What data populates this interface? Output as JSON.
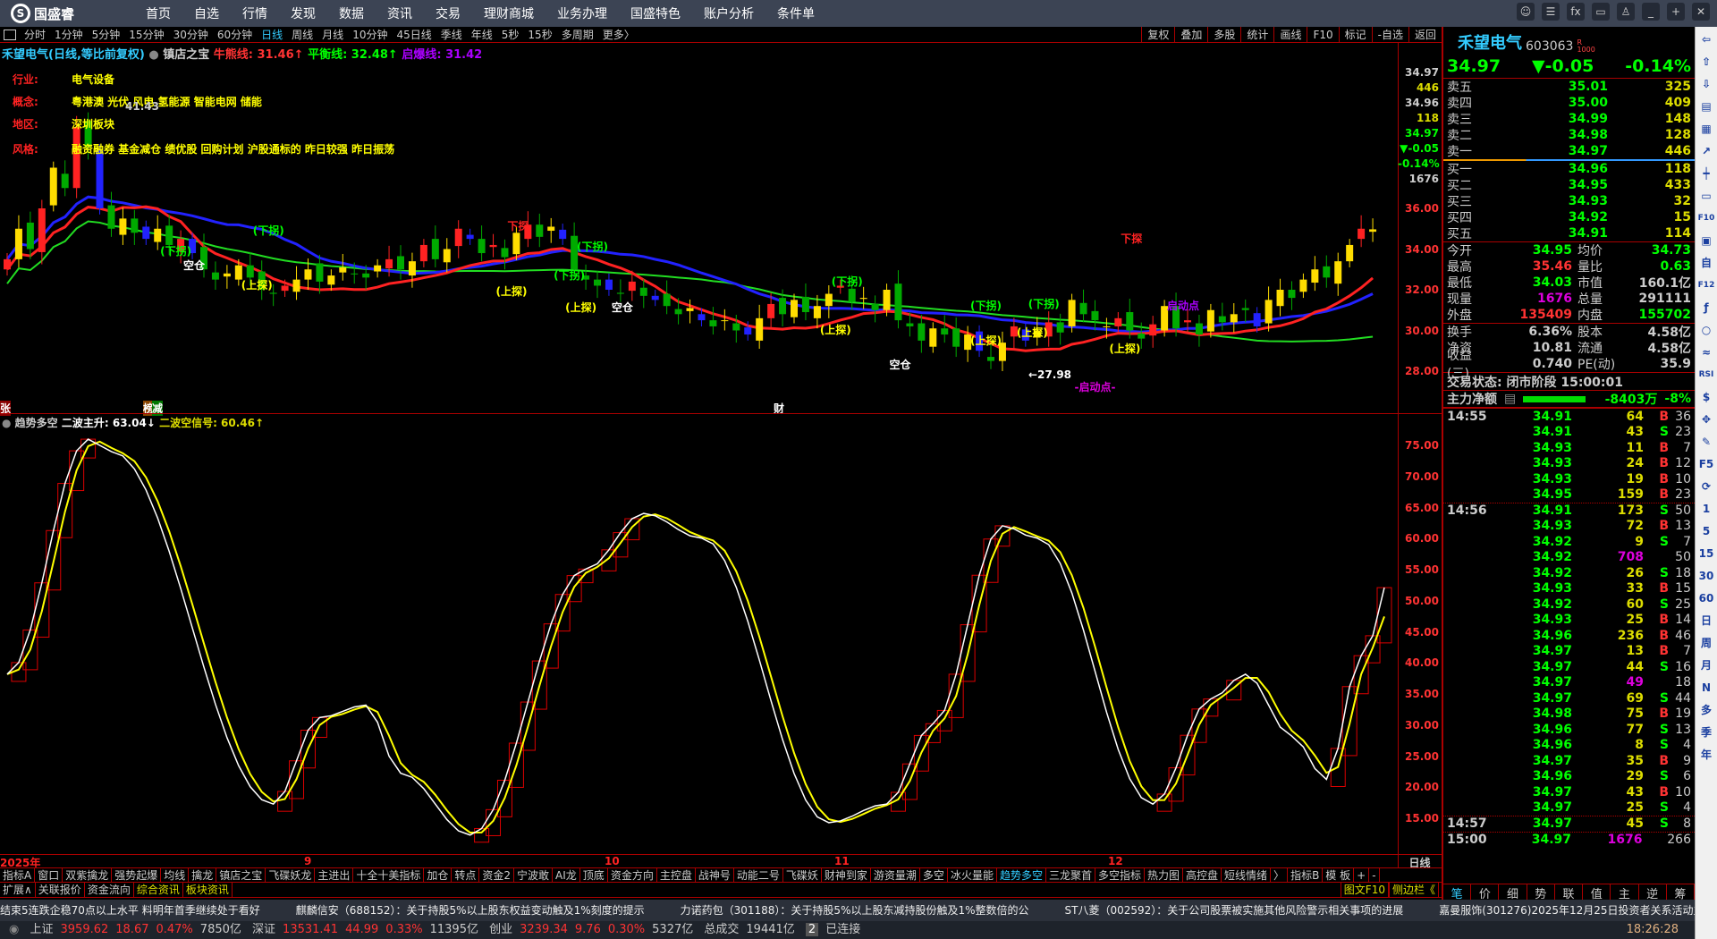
{
  "app": {
    "logo": "国盛睿",
    "menu": [
      "首页",
      "自选",
      "行情",
      "发现",
      "数据",
      "资讯",
      "交易",
      "理财商城",
      "业务办理",
      "国盛特色",
      "账户分析",
      "条件单"
    ],
    "window_buttons": [
      "chat-icon",
      "settings-sliders-icon",
      "fx-icon",
      "monitor-icon",
      "skin-icon",
      "minimize-icon",
      "restore-icon",
      "close-icon"
    ]
  },
  "toolbar": {
    "periods": [
      "分时",
      "1分钟",
      "5分钟",
      "15分钟",
      "30分钟",
      "60分钟",
      "日线",
      "周线",
      "月线",
      "10分钟",
      "45日线",
      "季线",
      "年线",
      "5秒",
      "15秒",
      "多周期",
      "更多〉"
    ],
    "active": "日线",
    "right": [
      "复权",
      "叠加",
      "多股",
      "统计",
      "画线",
      "F10",
      "标记",
      "-自选",
      "返回"
    ]
  },
  "chart": {
    "title": "禾望电气(日线,等比前复权)",
    "indicator": "镇店之宝",
    "bull_line": "牛熊线: 31.46↑",
    "balance_line": "平衡线: 32.48↑",
    "burst_line": "启爆线: 31.42",
    "info": [
      {
        "k": "行业:",
        "v": "电气设备"
      },
      {
        "k": "概念:",
        "v": "粤港澳 光伏 风电 氢能源 智能电网 储能"
      },
      {
        "k": "地区:",
        "v": "深圳板块"
      },
      {
        "k": "风格:",
        "v": "融资融券 基金减仓 绩优股 回购计划 沪股通标的 昨日较强 昨日振荡"
      }
    ],
    "high_label": "41.43",
    "low_label": "←27.98",
    "markers": [
      "张",
      "榜",
      "减",
      "财"
    ],
    "annotations": [
      {
        "t": "(下拐)",
        "c": "#0f0",
        "idx": 22,
        "p": 35.3
      },
      {
        "t": "(下拐)",
        "c": "#0f0",
        "idx": 14,
        "p": 34.3
      },
      {
        "t": "空仓",
        "c": "#fff",
        "idx": 16,
        "p": 33.6
      },
      {
        "t": "(上探)",
        "c": "#ff0",
        "idx": 21,
        "p": 32.6
      },
      {
        "t": "下探",
        "c": "#f22",
        "idx": 44,
        "p": 35.5
      },
      {
        "t": "(上探)",
        "c": "#ff0",
        "idx": 43,
        "p": 32.3
      },
      {
        "t": "(下拐)",
        "c": "#0f0",
        "idx": 48,
        "p": 33.1
      },
      {
        "t": "(下拐)",
        "c": "#0f0",
        "idx": 50,
        "p": 34.5
      },
      {
        "t": "(上探)",
        "c": "#ff0",
        "idx": 49,
        "p": 31.5
      },
      {
        "t": "空仓",
        "c": "#fff",
        "idx": 53,
        "p": 31.5
      },
      {
        "t": "(下拐)",
        "c": "#0f0",
        "idx": 72,
        "p": 32.8
      },
      {
        "t": "(上探)",
        "c": "#ff0",
        "idx": 71,
        "p": 30.4
      },
      {
        "t": "空仓",
        "c": "#fff",
        "idx": 77,
        "p": 28.7
      },
      {
        "t": "(下拐)",
        "c": "#0f0",
        "idx": 84,
        "p": 31.6
      },
      {
        "t": "(上探)",
        "c": "#ff0",
        "idx": 84,
        "p": 29.9
      },
      {
        "t": "(下拐)",
        "c": "#0f0",
        "idx": 89,
        "p": 31.7
      },
      {
        "t": "(上探)",
        "c": "#ff0",
        "idx": 96,
        "p": 29.5
      },
      {
        "t": "(上探)",
        "c": "#ff0",
        "idx": 88,
        "p": 30.3
      },
      {
        "t": "下探",
        "c": "#f22",
        "idx": 97,
        "p": 34.9
      },
      {
        "t": "启动点",
        "c": "#a0f",
        "idx": 101,
        "p": 31.6
      },
      {
        "t": "-启动点-",
        "c": "#d0d",
        "idx": 93,
        "p": 27.6
      }
    ],
    "price_axis": [
      "36.00",
      "34.00",
      "32.00",
      "30.00",
      "28.00"
    ],
    "axis_quote": [
      {
        "t": "34.97",
        "c": "#ccc"
      },
      {
        "t": "446",
        "c": "#dd0"
      },
      {
        "t": "34.96",
        "c": "#ccc"
      },
      {
        "t": "118",
        "c": "#dd0"
      },
      {
        "t": "34.97",
        "c": "#0f0"
      },
      {
        "t": "▼-0.05",
        "c": "#0f0"
      },
      {
        "t": "-0.14%",
        "c": "#0f0"
      },
      {
        "t": "1676",
        "c": "#ccc"
      }
    ],
    "closes": [
      33.5,
      35,
      34,
      36,
      38,
      37,
      40,
      39,
      36,
      35,
      35.5,
      34.8,
      34.5,
      35,
      34.2,
      34.5,
      33.8,
      33,
      32.5,
      32.8,
      33.2,
      32.6,
      32.0,
      31.8,
      32.2,
      32.5,
      33,
      32.4,
      32.7,
      33.1,
      32.8,
      32.6,
      33.2,
      33.5,
      33.0,
      33.4,
      34.2,
      33.5,
      34,
      35.0,
      34.5,
      33.8,
      34.2,
      33.6,
      34.8,
      35.2,
      34.6,
      35.1,
      34.5,
      33,
      32.5,
      32.2,
      32.0,
      31.8,
      32.4,
      31.7,
      31.5,
      31.2,
      30.8,
      31.1,
      30.5,
      30.2,
      30.5,
      30.0,
      29.8,
      30.6,
      31.3,
      30.8,
      31.5,
      30.9,
      31.2,
      31.8,
      32.2,
      31.4,
      31.6,
      31.0,
      32.0,
      30.5,
      30.2,
      29.5,
      30.1,
      29.8,
      29.2,
      29.8,
      29.0,
      28.5,
      29.4,
      30.2,
      29.5,
      30.0,
      30.4,
      29.9,
      31.5,
      30.8,
      30.5,
      30.2,
      30.6,
      30.0,
      29.6,
      30.3,
      31.2,
      30.1,
      30.5,
      29.8,
      31,
      30.4,
      30.8,
      31.0,
      30.2,
      31.5,
      32.0,
      31.6,
      32.5,
      33.0,
      32.6,
      33.4,
      34.2,
      35.0,
      34.97
    ]
  },
  "indicator": {
    "name": "趋势多空",
    "main": "二波主升: 63.04↓",
    "signal": "二波空信号: 60.46↑",
    "axis": [
      "75.00",
      "70.00",
      "65.00",
      "60.00",
      "55.00",
      "50.00",
      "45.00",
      "40.00",
      "35.00",
      "30.00",
      "25.00",
      "20.00",
      "15.00"
    ],
    "keypoints": [
      [
        0,
        38
      ],
      [
        7,
        76
      ],
      [
        9,
        74
      ],
      [
        23,
        17
      ],
      [
        27,
        31
      ],
      [
        31,
        33
      ],
      [
        34,
        22
      ],
      [
        40,
        12
      ],
      [
        50,
        55
      ],
      [
        55,
        64
      ],
      [
        60,
        60
      ],
      [
        71,
        14
      ],
      [
        76,
        17
      ],
      [
        80,
        30
      ],
      [
        86,
        62
      ],
      [
        89,
        60
      ],
      [
        99,
        17
      ],
      [
        104,
        34
      ],
      [
        107,
        38
      ],
      [
        111,
        28
      ],
      [
        114,
        21
      ],
      [
        117,
        41
      ],
      [
        121,
        63
      ],
      [
        122,
        62
      ]
    ]
  },
  "date_axis": {
    "labels": [
      "2025年",
      "9",
      "10",
      "11",
      "12"
    ],
    "period": "日线"
  },
  "tabs_row1": [
    "指标A",
    "窗口",
    "双紫擒龙",
    "强势起爆",
    "均线",
    "擒龙",
    "镇店之宝",
    "飞碟妖龙",
    "主进出",
    "十全十美指标",
    "加仓",
    "转点",
    "资金2",
    "宁波敢",
    "AI龙",
    "顶底",
    "资金方向",
    "主控盘",
    "战神号",
    "动能二号",
    "飞碟妖",
    "财神到家",
    "游资量潮",
    "多空",
    "冰火量能",
    "趋势多空",
    "三龙聚首",
    "多空指标",
    "热力图",
    "高控盘",
    "短线情绪",
    "〉",
    "指标B",
    "模 板",
    "+",
    "-"
  ],
  "tabs_row1_active": "趋势多空",
  "tabs_row2": [
    "扩展∧",
    "关联报价",
    "资金流向",
    "综合资讯",
    "板块资讯"
  ],
  "tabs_row2_right": [
    "图文F10",
    "侧边栏《"
  ],
  "quote": {
    "name": "禾望电气",
    "code": "603063",
    "tag_r": "R",
    "tag_num": "1000",
    "price": "34.97",
    "change": "▼-0.05",
    "pct": "-0.14%",
    "asks": [
      {
        "l": "卖五",
        "p": "35.01",
        "v": "325"
      },
      {
        "l": "卖四",
        "p": "35.00",
        "v": "409"
      },
      {
        "l": "卖三",
        "p": "34.99",
        "v": "148"
      },
      {
        "l": "卖二",
        "p": "34.98",
        "v": "128"
      },
      {
        "l": "卖一",
        "p": "34.97",
        "v": "446"
      }
    ],
    "bids": [
      {
        "l": "买一",
        "p": "34.96",
        "v": "118"
      },
      {
        "l": "买二",
        "p": "34.95",
        "v": "433"
      },
      {
        "l": "买三",
        "p": "34.93",
        "v": "32"
      },
      {
        "l": "买四",
        "p": "34.92",
        "v": "15"
      },
      {
        "l": "买五",
        "p": "34.91",
        "v": "114"
      }
    ],
    "stats": [
      [
        "今开",
        "34.95",
        "g",
        "均价",
        "34.73",
        "g"
      ],
      [
        "最高",
        "35.46",
        "r",
        "量比",
        "0.63",
        "g"
      ],
      [
        "最低",
        "34.03",
        "g",
        "市值",
        "160.1亿",
        "w"
      ],
      [
        "现量",
        "1676",
        "p",
        "总量",
        "291111",
        "w"
      ],
      [
        "外盘",
        "135409",
        "r",
        "内盘",
        "155702",
        "g"
      ]
    ],
    "stats2": [
      [
        "换手",
        "6.36%",
        "w",
        "股本",
        "4.58亿",
        "w"
      ],
      [
        "净资",
        "10.81",
        "w",
        "流通",
        "4.58亿",
        "w"
      ],
      [
        "收益(三)",
        "0.740",
        "w",
        "PE(动)",
        "35.9",
        "w"
      ]
    ],
    "trade_status": "交易状态: 闭市阶段 15:00:01",
    "main_net_label": "主力净额",
    "main_net": "-8403万",
    "main_net_pct": "-8%"
  },
  "ticks": [
    [
      "14:55",
      "34.91",
      "64",
      "B",
      "36"
    ],
    [
      "",
      "34.91",
      "43",
      "S",
      "23"
    ],
    [
      "",
      "34.93",
      "11",
      "B",
      "7"
    ],
    [
      "",
      "34.93",
      "24",
      "B",
      "12"
    ],
    [
      "",
      "34.93",
      "19",
      "B",
      "10"
    ],
    [
      "",
      "34.95",
      "159",
      "B",
      "23"
    ],
    [
      "14:56",
      "34.91",
      "173",
      "S",
      "50"
    ],
    [
      "",
      "34.93",
      "72",
      "B",
      "13"
    ],
    [
      "",
      "34.92",
      "9",
      "S",
      "7"
    ],
    [
      "",
      "34.92",
      "708",
      "",
      "50"
    ],
    [
      "",
      "34.92",
      "26",
      "S",
      "18"
    ],
    [
      "",
      "34.93",
      "33",
      "B",
      "15"
    ],
    [
      "",
      "34.92",
      "60",
      "S",
      "25"
    ],
    [
      "",
      "34.93",
      "25",
      "B",
      "14"
    ],
    [
      "",
      "34.96",
      "236",
      "B",
      "46"
    ],
    [
      "",
      "34.97",
      "13",
      "B",
      "7"
    ],
    [
      "",
      "34.97",
      "44",
      "S",
      "16"
    ],
    [
      "",
      "34.97",
      "49",
      "",
      "18"
    ],
    [
      "",
      "34.97",
      "69",
      "S",
      "44"
    ],
    [
      "",
      "34.98",
      "75",
      "B",
      "19"
    ],
    [
      "",
      "34.96",
      "77",
      "S",
      "13"
    ],
    [
      "",
      "34.96",
      "8",
      "S",
      "4"
    ],
    [
      "",
      "34.97",
      "35",
      "B",
      "9"
    ],
    [
      "",
      "34.96",
      "29",
      "S",
      "6"
    ],
    [
      "",
      "34.97",
      "43",
      "B",
      "10"
    ],
    [
      "",
      "34.97",
      "25",
      "S",
      "4"
    ],
    [
      "14:57",
      "34.97",
      "45",
      "S",
      "8"
    ],
    [
      "15:00",
      "34.97",
      "1676",
      "",
      "266"
    ]
  ],
  "tick_tabs": [
    "笔",
    "价",
    "细",
    "势",
    "联",
    "值",
    "主",
    "逆",
    "筹"
  ],
  "side_icons": [
    "⇦",
    "⇧",
    "⇩",
    "▤",
    "▦",
    "↗",
    "┿",
    "▭",
    "F10",
    "▣",
    "自",
    "F12",
    "ƒ",
    "○",
    "≈",
    "RSI",
    "$",
    "✥",
    "✎",
    "F5",
    "⟳",
    "1",
    "5",
    "15",
    "30",
    "60",
    "日",
    "周",
    "月",
    "N",
    "多",
    "季",
    "年"
  ],
  "ticker": [
    "结束5连跌企稳70点以上水平 料明年首季继续处于看好",
    "麒麟信安（688152）：关于持股5%以上股东权益变动触及1%刻度的提示",
    "力诺药包（301188）：关于持股5%以上股东减持股份触及1%整数倍的公",
    "ST八菱（002592）：关于公司股票被实施其他风险警示相关事项的进展",
    "嘉曼服饰(301276)2025年12月25日投资者关系活动主要内容"
  ],
  "status": {
    "sh": "上证",
    "sh_v": "3959.62",
    "sh_c": "18.67",
    "sh_p": "0.47%",
    "sh_a": "7850亿",
    "sz": "深证",
    "sz_v": "13531.41",
    "sz_c": "44.99",
    "sz_p": "0.33%",
    "sz_a": "11395亿",
    "cy": "创业",
    "cy_v": "3239.34",
    "cy_c": "9.76",
    "cy_p": "0.30%",
    "cy_a": "5327亿",
    "total_label": "总成交",
    "total": "19441亿",
    "conn_num": "2",
    "conn": "已连接",
    "time": "18:26:28"
  }
}
